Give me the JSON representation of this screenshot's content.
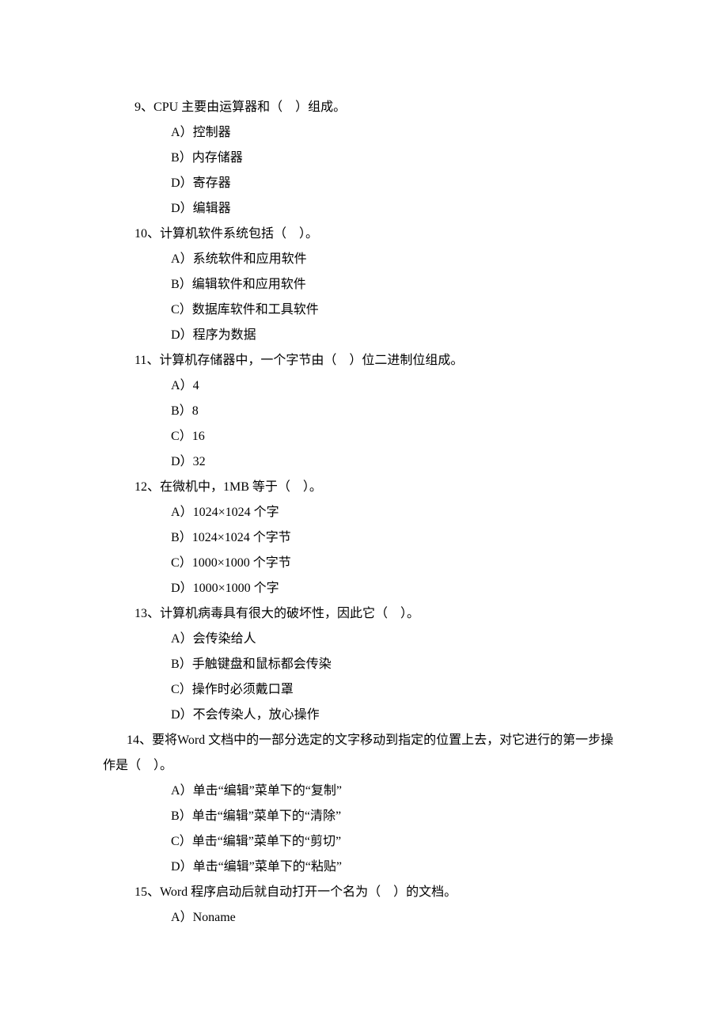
{
  "questions": [
    {
      "num": "9、",
      "text": "CPU 主要由运算器和（　）组成。",
      "options": [
        {
          "label": "A）",
          "text": "控制器"
        },
        {
          "label": "B）",
          "text": "内存储器"
        },
        {
          "label": "D）",
          "text": "寄存器"
        },
        {
          "label": "D）",
          "text": "编辑器"
        }
      ]
    },
    {
      "num": "10、",
      "text": "计算机软件系统包括（　）。",
      "options": [
        {
          "label": "A）",
          "text": "系统软件和应用软件"
        },
        {
          "label": "B）",
          "text": "编辑软件和应用软件"
        },
        {
          "label": "C）",
          "text": "数据库软件和工具软件"
        },
        {
          "label": "D）",
          "text": "程序为数据"
        }
      ]
    },
    {
      "num": "11、",
      "text": "计算机存储器中，一个字节由（　）位二进制位组成。",
      "options": [
        {
          "label": "A）",
          "text": "4"
        },
        {
          "label": "B）",
          "text": "8"
        },
        {
          "label": "C）",
          "text": "16"
        },
        {
          "label": "D）",
          "text": "32"
        }
      ]
    },
    {
      "num": "12、",
      "text": "在微机中，1MB 等于（　）。",
      "options": [
        {
          "label": "A）",
          "text": "1024×1024 个字"
        },
        {
          "label": "B）",
          "text": "1024×1024 个字节"
        },
        {
          "label": "C）",
          "text": "1000×1000 个字节"
        },
        {
          "label": "D）",
          "text": "1000×1000 个字"
        }
      ]
    },
    {
      "num": "13、",
      "text": "计算机病毒具有很大的破坏性，因此它（　）。",
      "options": [
        {
          "label": "A）",
          "text": "会传染给人"
        },
        {
          "label": "B）",
          "text": "手触键盘和鼠标都会传染"
        },
        {
          "label": "C）",
          "text": "操作时必须戴口罩"
        },
        {
          "label": "D）",
          "text": "不会传染人，放心操作"
        }
      ]
    },
    {
      "num": "14、",
      "text": "要将Word 文档中的一部分选定的文字移动到指定的位置上去，对它进行的第一步操作是（　）。",
      "wrap": true,
      "options": [
        {
          "label": "A）",
          "text": "单击“编辑”菜单下的“复制”"
        },
        {
          "label": "B）",
          "text": "单击“编辑”菜单下的“清除”"
        },
        {
          "label": "C）",
          "text": "单击“编辑”菜单下的“剪切”"
        },
        {
          "label": "D）",
          "text": "单击“编辑”菜单下的“粘贴”"
        }
      ]
    },
    {
      "num": "15、",
      "text": "Word 程序启动后就自动打开一个名为（　）的文档。",
      "options": [
        {
          "label": "A）",
          "text": "Noname"
        }
      ]
    }
  ]
}
